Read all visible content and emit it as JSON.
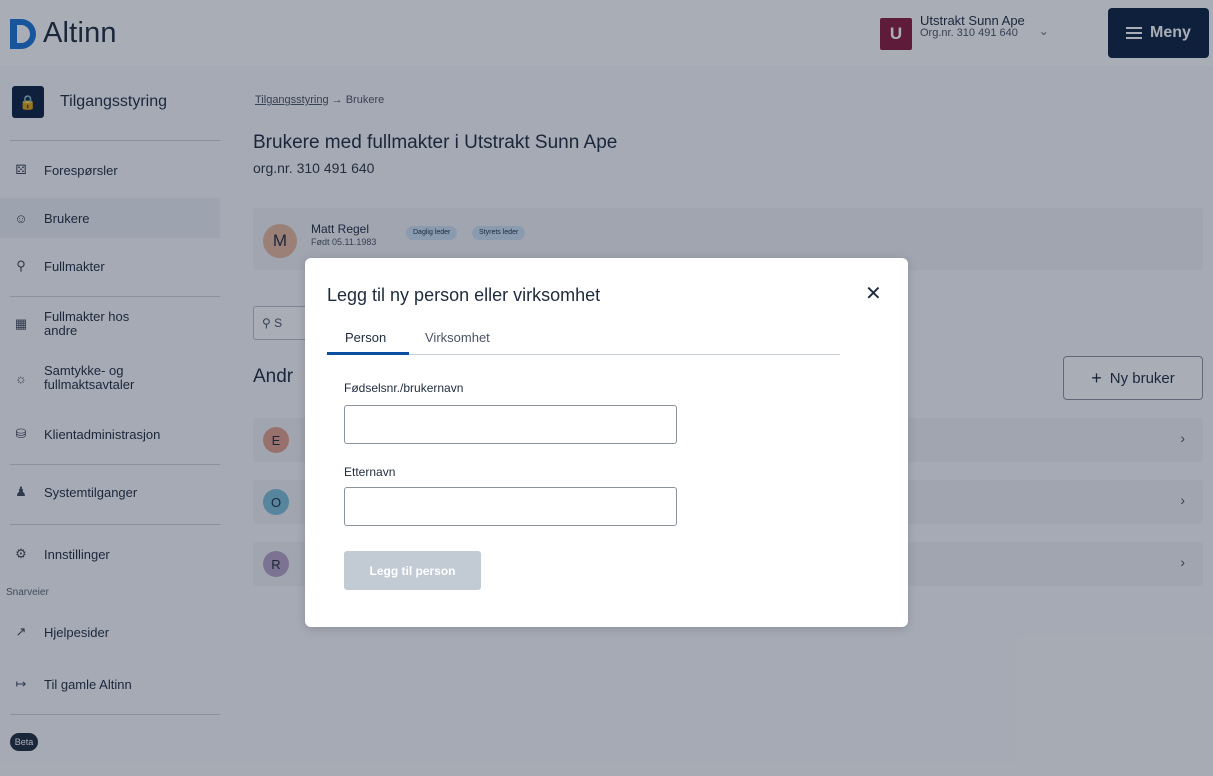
{
  "header": {
    "logo_text": "Altinn",
    "account": {
      "avatar_letter": "U",
      "name": "Utstrakt Sunn Ape",
      "org": "Org.nr. 310 491 640"
    },
    "menu_label": "Meny"
  },
  "sidebar": {
    "heading": "Tilgangsstyring",
    "items": [
      {
        "label": "Forespørsler",
        "icon": "bell-icon"
      },
      {
        "label": "Brukere",
        "icon": "users-icon"
      },
      {
        "label": "Fullmakter",
        "icon": "key-icon"
      },
      {
        "label": "Fullmakter hos andre",
        "icon": "lock-open-icon"
      },
      {
        "label": "Samtykke- og fullmaktsavtaler",
        "icon": "handshake-icon"
      },
      {
        "label": "Klientadministrasjon",
        "icon": "database-icon"
      },
      {
        "label": "Systemtilganger",
        "icon": "system-user-icon"
      },
      {
        "label": "Innstillinger",
        "icon": "gear-icon"
      }
    ],
    "shortcuts_label": "Snarveier",
    "shortcuts": [
      {
        "label": "Hjelpesider",
        "icon": "external-link-icon"
      },
      {
        "label": "Til gamle Altinn",
        "icon": "enter-icon"
      }
    ],
    "beta_label": "Beta"
  },
  "main": {
    "breadcrumb": {
      "link": "Tilgangsstyring",
      "separator": "→",
      "current": "Brukere"
    },
    "title": "Brukere med fullmakter i Utstrakt Sunn Ape",
    "orgnr": "org.nr. 310 491 640",
    "owner": {
      "avatar": "M",
      "name": "Matt Regel",
      "born": "Født 05.11.1983",
      "badges": [
        "Daglig leder",
        "Styrets leder"
      ]
    },
    "search_placeholder": "S",
    "section_title": "Andr",
    "new_user_label": "Ny bruker",
    "rows": [
      {
        "avatar": "E",
        "color": "#e6a08a"
      },
      {
        "avatar": "O",
        "color": "#7cc0d8"
      },
      {
        "avatar": "R",
        "color": "#b8a3c8"
      }
    ]
  },
  "modal": {
    "title": "Legg til ny person eller virksomhet",
    "tabs": [
      "Person",
      "Virksomhet"
    ],
    "active_tab": "Person",
    "fields": [
      {
        "label": "Fødselsnr./brukernavn",
        "value": ""
      },
      {
        "label": "Etternavn",
        "value": ""
      }
    ],
    "submit_label": "Legg til person"
  },
  "colors": {
    "brand_blue": "#1a74d6",
    "navy": "#0a213f",
    "account_avatar": "#8a1a3c",
    "disabled_button": "#c2cad4"
  }
}
